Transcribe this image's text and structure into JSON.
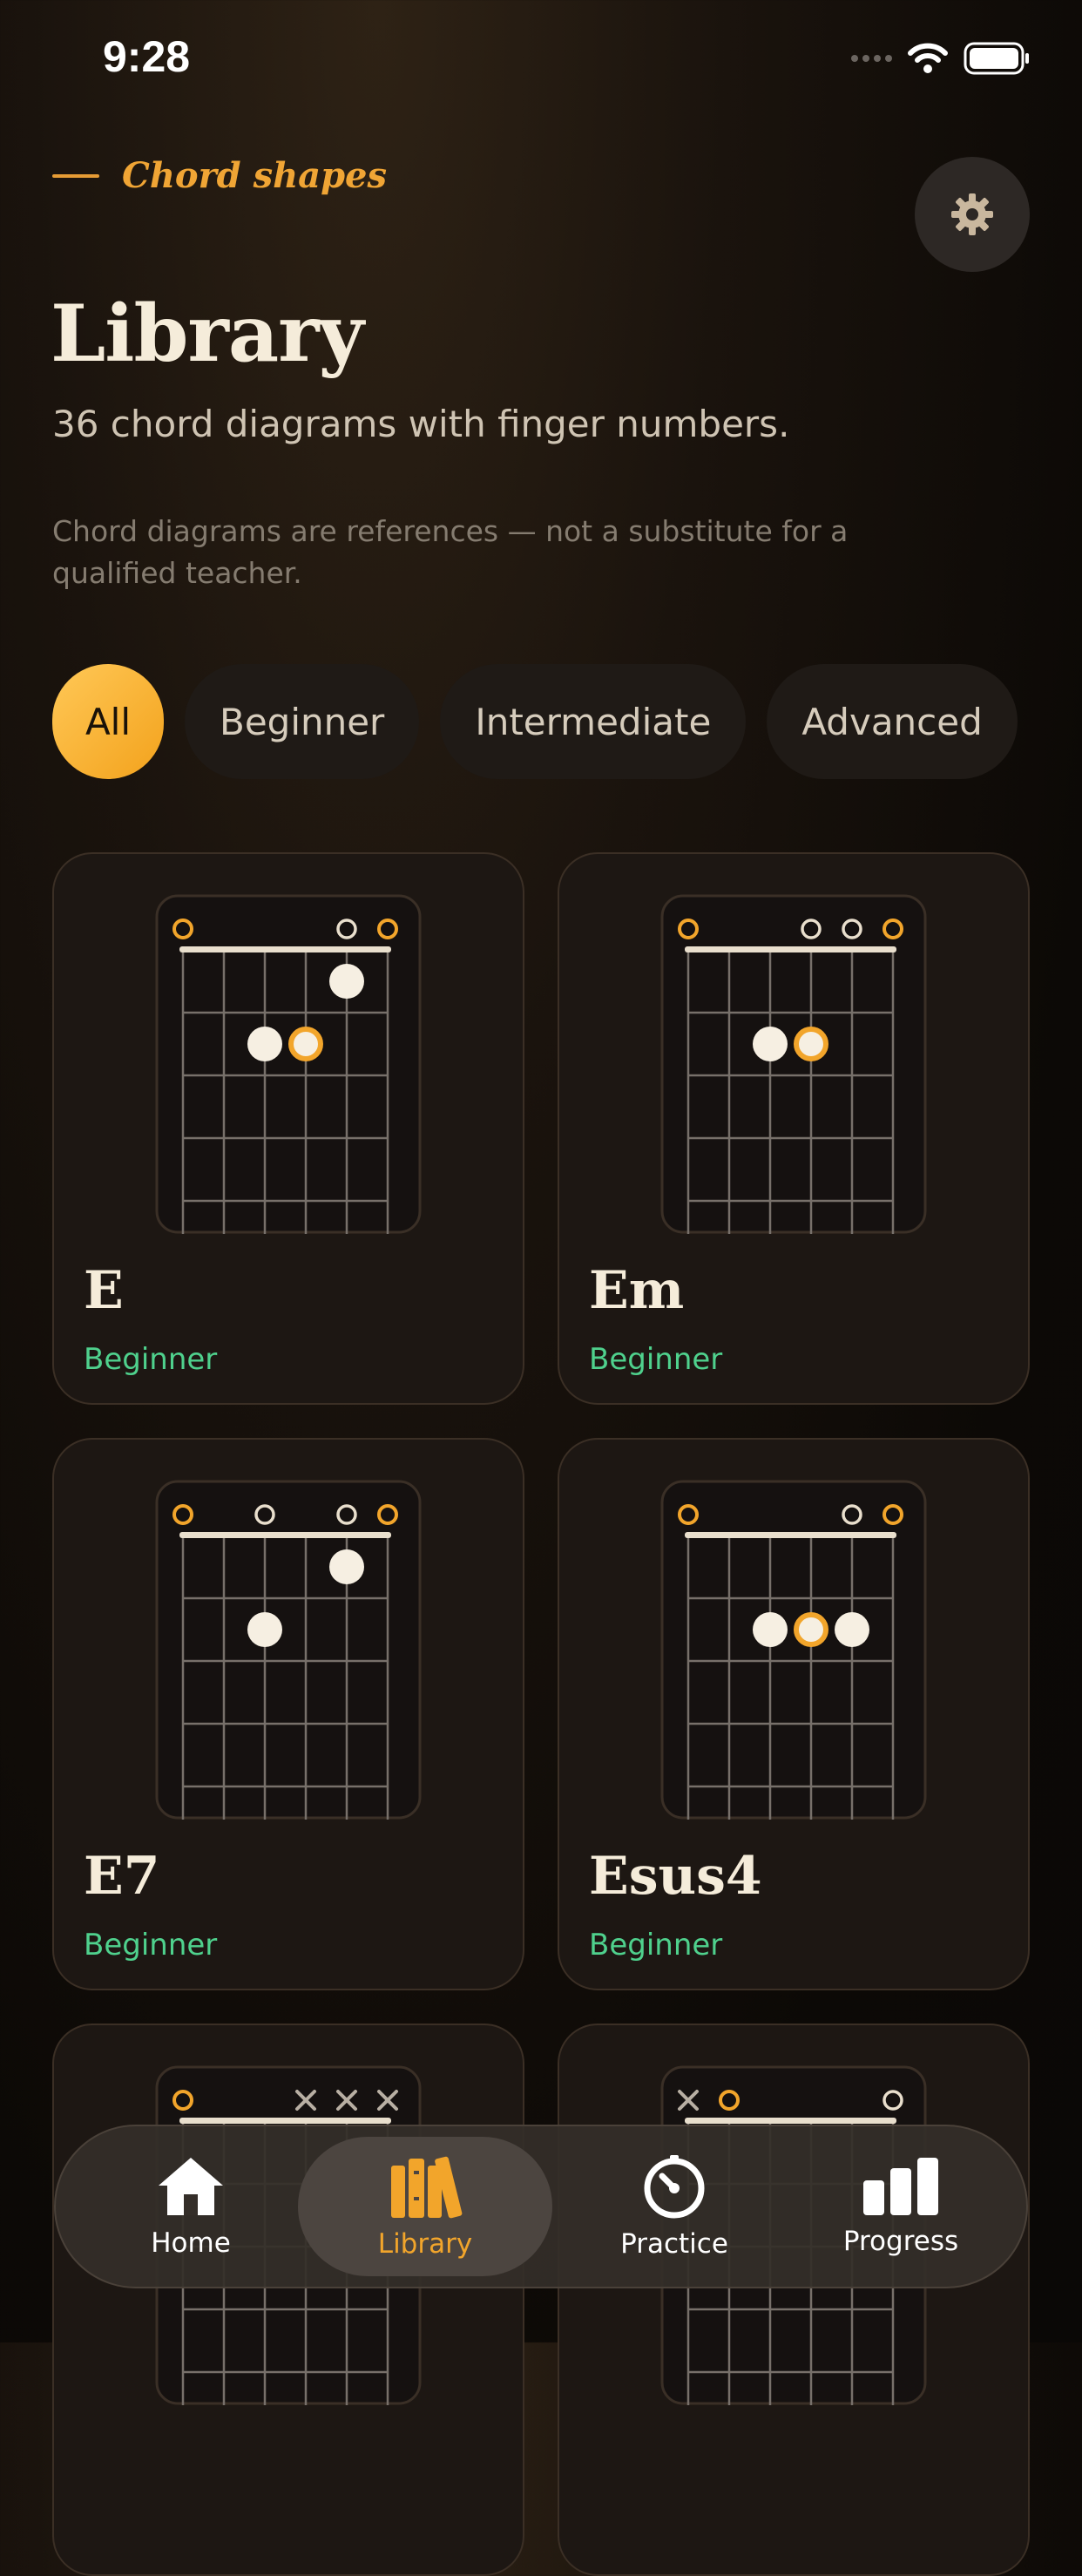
{
  "status": {
    "time": "9:28"
  },
  "header": {
    "eyebrow": "Chord shapes",
    "title": "Library",
    "subtitle": "36 chord diagrams with finger numbers.",
    "disclaimer": "Chord diagrams are references — not a substitute for a qualified teacher.",
    "settings_icon": "gear-icon"
  },
  "filters": [
    "All",
    "Beginner",
    "Intermediate",
    "Advanced"
  ],
  "selected_filter": "All",
  "chords": [
    {
      "name": "E",
      "level": "Beginner",
      "strings": [
        "root",
        "",
        "",
        "",
        "open",
        "root"
      ],
      "dots": [
        {
          "string": 4,
          "fret": 1,
          "root": false
        },
        {
          "string": 2,
          "fret": 2,
          "root": false
        },
        {
          "string": 3,
          "fret": 2,
          "root": true
        }
      ]
    },
    {
      "name": "Em",
      "level": "Beginner",
      "strings": [
        "root",
        "",
        "",
        "open",
        "open",
        "root"
      ],
      "dots": [
        {
          "string": 2,
          "fret": 2,
          "root": false
        },
        {
          "string": 3,
          "fret": 2,
          "root": true
        }
      ]
    },
    {
      "name": "E7",
      "level": "Beginner",
      "strings": [
        "root",
        "",
        "open",
        "",
        "open",
        "root"
      ],
      "dots": [
        {
          "string": 4,
          "fret": 1,
          "root": false
        },
        {
          "string": 2,
          "fret": 2,
          "root": false
        }
      ]
    },
    {
      "name": "Esus4",
      "level": "Beginner",
      "strings": [
        "root",
        "",
        "",
        "",
        "open",
        "root"
      ],
      "dots": [
        {
          "string": 2,
          "fret": 2,
          "root": false
        },
        {
          "string": 3,
          "fret": 2,
          "root": true
        },
        {
          "string": 4,
          "fret": 2,
          "root": false
        }
      ]
    },
    {
      "name": "",
      "level": "",
      "strings": [
        "root",
        "",
        "",
        "muted",
        "muted",
        "muted"
      ],
      "dots": []
    },
    {
      "name": "",
      "level": "",
      "strings": [
        "muted",
        "root",
        "",
        "",
        "",
        "open"
      ],
      "dots": []
    }
  ],
  "tabbar": [
    {
      "label": "Home",
      "icon": "home-icon",
      "active": false
    },
    {
      "label": "Library",
      "icon": "library-books-icon",
      "active": true
    },
    {
      "label": "Practice",
      "icon": "timer-gauge-icon",
      "active": false
    },
    {
      "label": "Progress",
      "icon": "bar-chart-icon",
      "active": false
    }
  ],
  "colors": {
    "accent": "#f2a52b",
    "beginner": "#4fd18d",
    "background": "#120e0a"
  }
}
